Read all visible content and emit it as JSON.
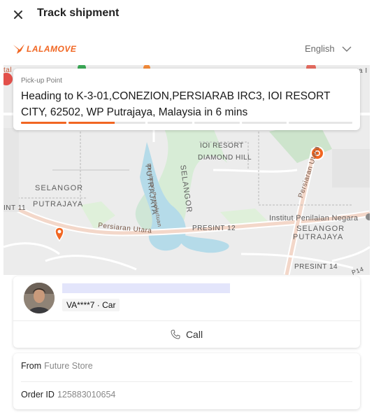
{
  "header": {
    "title": "Track shipment",
    "close_icon": "close-icon"
  },
  "brand": {
    "logo_text": "LALAMOVE",
    "logo_color": "#f16622",
    "language": "English"
  },
  "map": {
    "labels": {
      "ioi_resort": "IOI RESORT",
      "diamond_hill": "DIAMOND HILL",
      "selangor_left": "SELANGOR",
      "putrajaya_left": "PUTRAJAYA",
      "int11": "INT 11",
      "putrajaya_vert": "PUTRAJAYA",
      "selangor_vert": "SELANGOR",
      "persiaran_persekutuan": "Persiaran Persekutuan",
      "persiaran_utara_left": "Persiaran Utara",
      "persiaran_utara_right": "Persiaran Utara",
      "presint12": "PRESINT 12",
      "institut": "Institut Penilaian Negara",
      "selangor_right": "SELANGOR",
      "putrajaya_right": "PUTRAJAYA",
      "presint14": "PRESINT 14",
      "p14": "P14",
      "tal": "tal",
      "ga_i": "ga I"
    }
  },
  "pickup": {
    "label": "Pick-up Point",
    "text": "Heading to K-3-01,CONEZION,PERSIARAB IRC3, IOI RESORT CITY, 62502, WP Putrajaya, Malaysia in 6 mins",
    "accent": "#f16622"
  },
  "driver": {
    "plate": "VA****7 · Car",
    "call_label": "Call"
  },
  "order": {
    "from_label": "From",
    "from_value": "Future Store",
    "id_label": "Order ID",
    "id_value": "125883010654"
  }
}
